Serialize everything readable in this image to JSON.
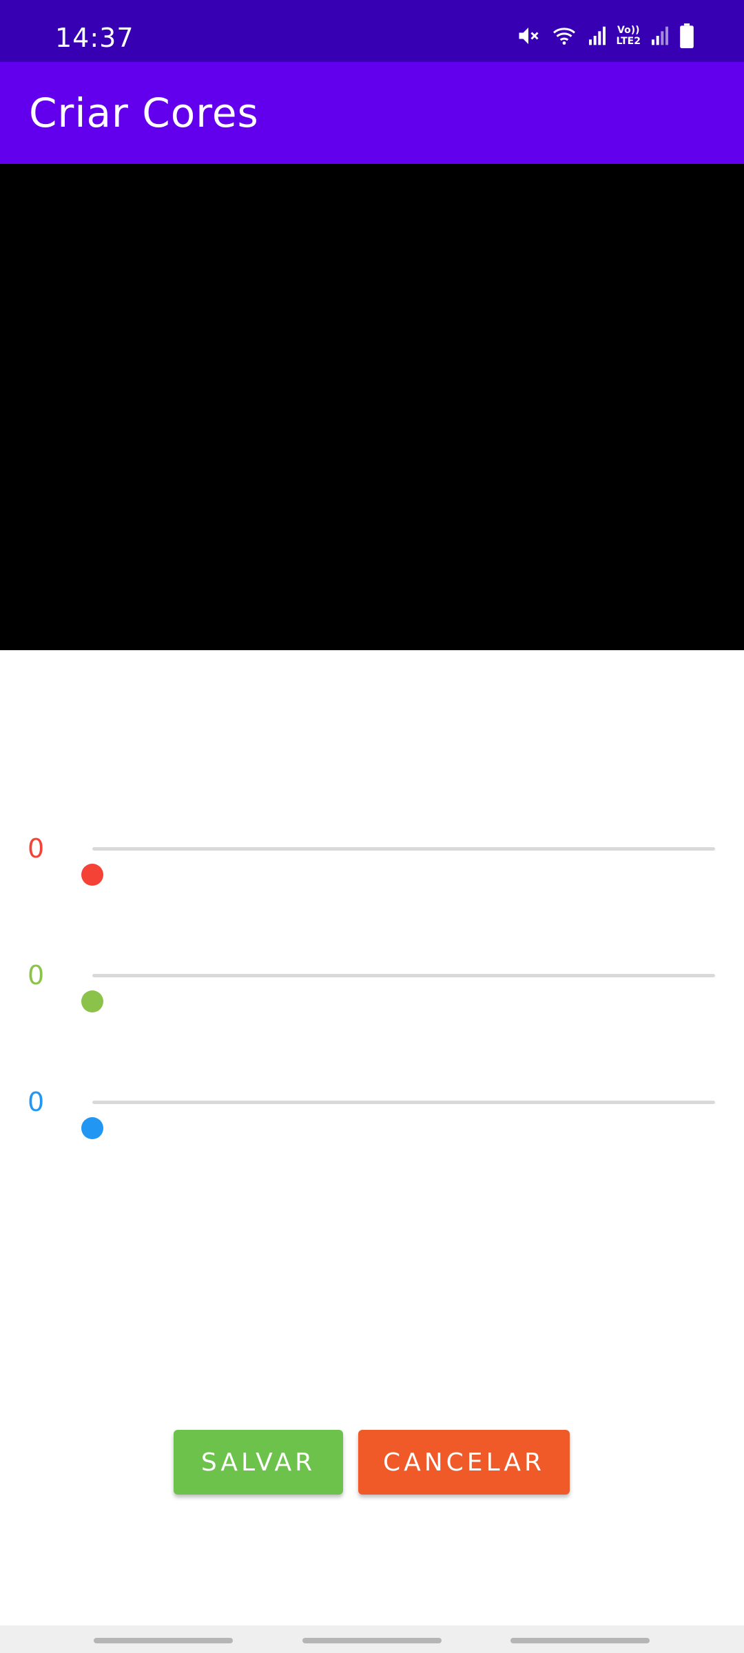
{
  "status_bar": {
    "time": "14:37",
    "icons": [
      "mute-icon",
      "wifi-icon",
      "signal-icon",
      "lte-icon",
      "signal-icon",
      "battery-icon"
    ],
    "lte_top": "Vo))",
    "lte_bottom": "LTE2",
    "background": "#3700b3"
  },
  "app_bar": {
    "title": "Criar Cores",
    "background": "#6200ee"
  },
  "preview": {
    "color": "#000000"
  },
  "sliders": [
    {
      "name": "red",
      "value": "0",
      "level": 0,
      "max": 255,
      "color": "#f44336"
    },
    {
      "name": "green",
      "value": "0",
      "level": 0,
      "max": 255,
      "color": "#8bc34a"
    },
    {
      "name": "blue",
      "value": "0",
      "level": 0,
      "max": 255,
      "color": "#2196f3"
    }
  ],
  "buttons": {
    "save_label": "SALVAR",
    "save_color": "#6cc24a",
    "cancel_label": "CANCELAR",
    "cancel_color": "#f05a28"
  }
}
